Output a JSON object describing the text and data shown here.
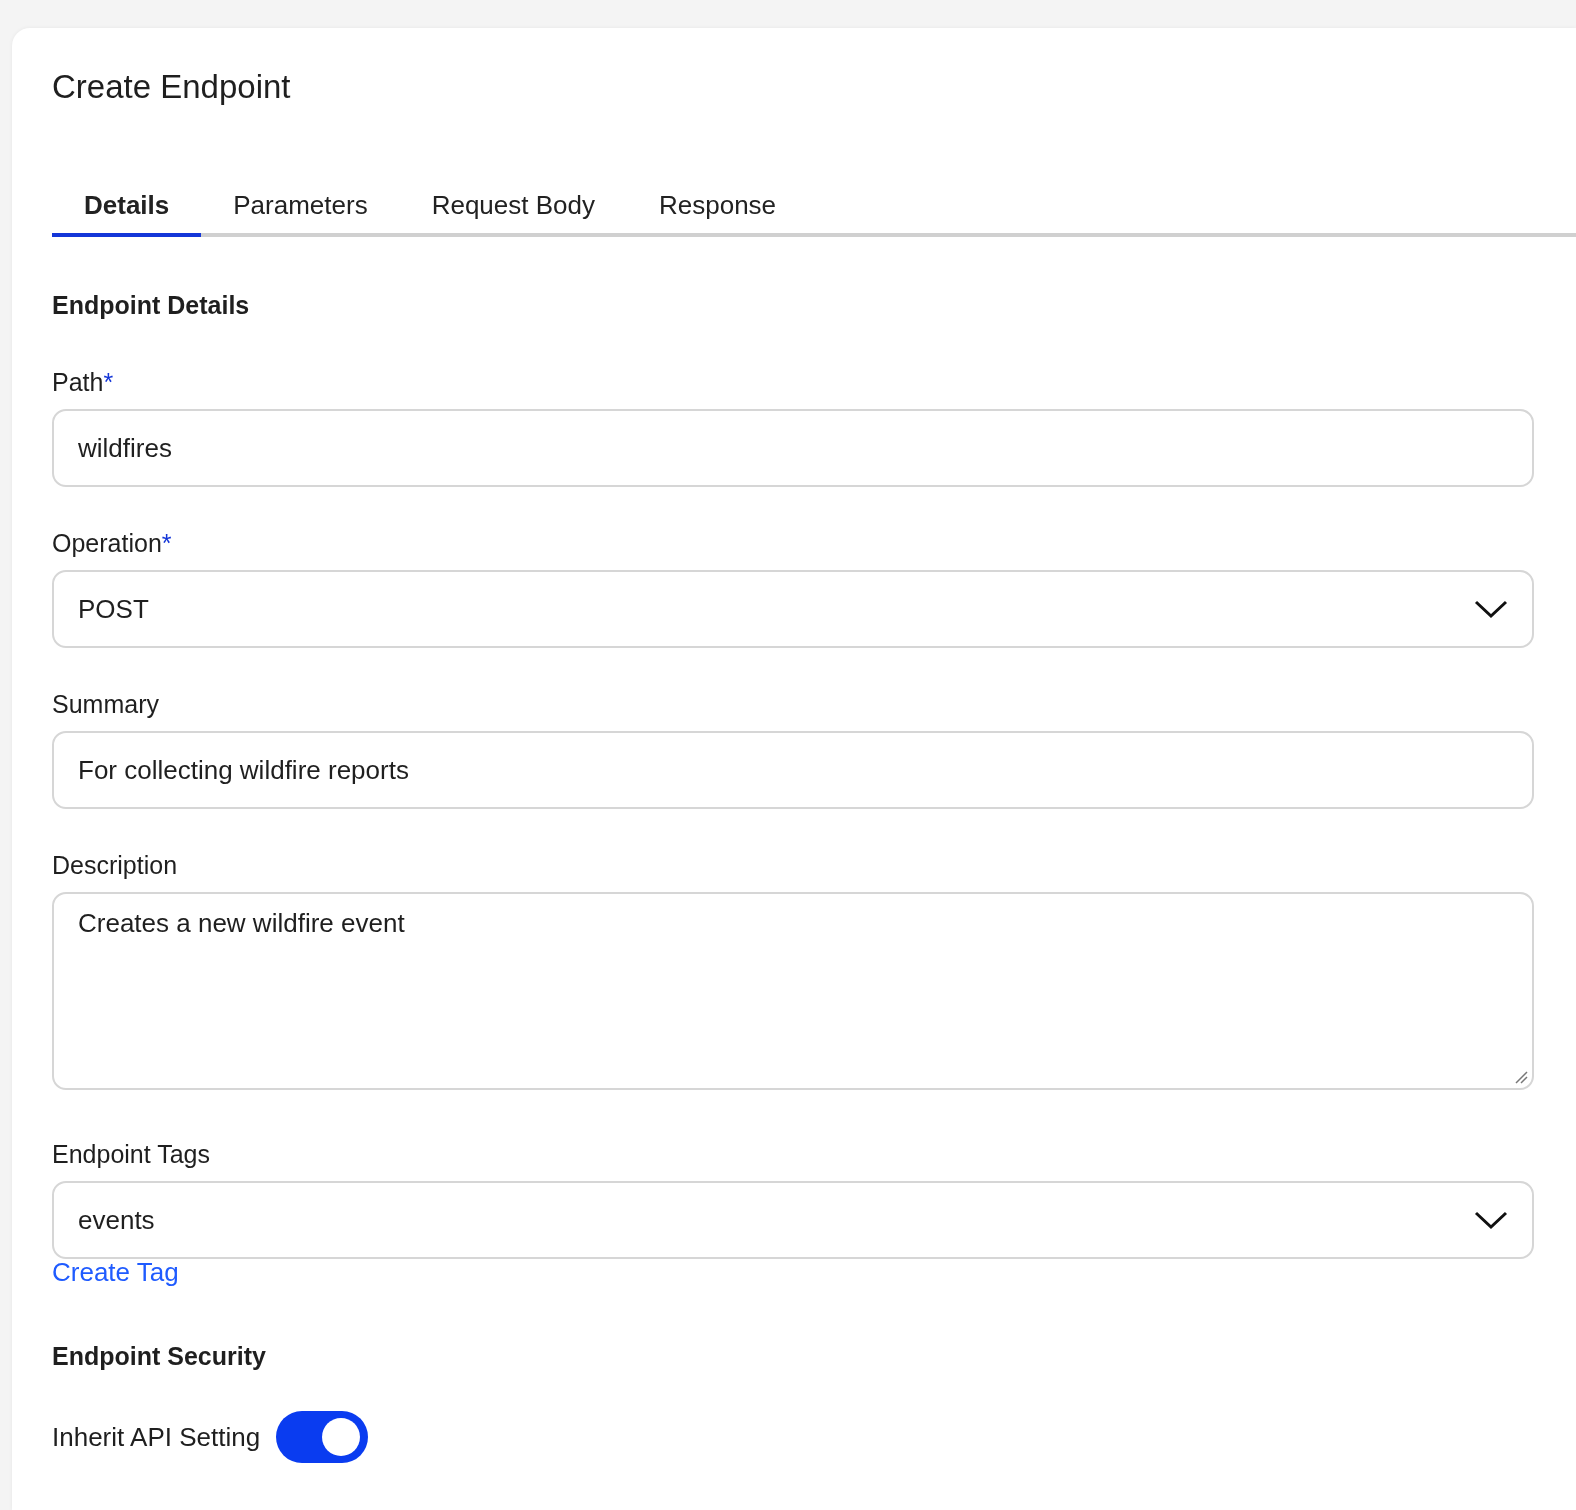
{
  "title": "Create Endpoint",
  "tabs": [
    {
      "label": "Details",
      "selected": true
    },
    {
      "label": "Parameters",
      "selected": false
    },
    {
      "label": "Request Body",
      "selected": false
    },
    {
      "label": "Response",
      "selected": false
    }
  ],
  "details_heading": "Endpoint Details",
  "required_marker": "*",
  "fields": [
    {
      "kind": "text",
      "label": "Path",
      "required": true,
      "value": "wildfires"
    },
    {
      "kind": "select",
      "label": "Operation",
      "required": true,
      "value": "POST"
    },
    {
      "kind": "text",
      "label": "Summary",
      "required": false,
      "value": "For collecting wildfire reports"
    },
    {
      "kind": "textarea",
      "label": "Description",
      "required": false,
      "value": "Creates a new wildfire event"
    },
    {
      "kind": "select",
      "label": "Endpoint Tags",
      "required": false,
      "value": "events"
    }
  ],
  "create_tag_link": "Create Tag",
  "security_heading": "Endpoint Security",
  "inherit_toggle": {
    "label": "Inherit API Setting",
    "on": true
  }
}
